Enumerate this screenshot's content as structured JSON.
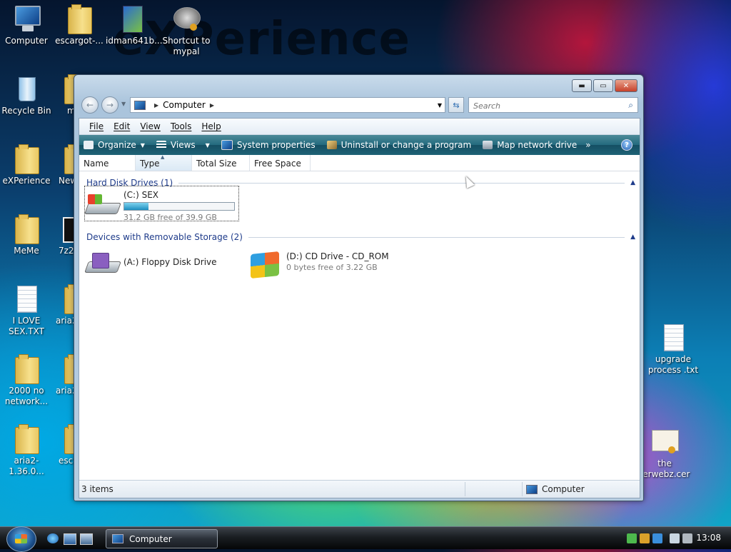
{
  "desktop": {
    "watermark": "eXPerience",
    "icons": [
      {
        "label": "Computer"
      },
      {
        "label": "escargot-..."
      },
      {
        "label": "idman641b..."
      },
      {
        "label": "Shortcut to mypal"
      },
      {
        "label": "Recycle Bin"
      },
      {
        "label": "eXPerience"
      },
      {
        "label": "MeMe"
      },
      {
        "label": "I LOVE SEX.TXT"
      },
      {
        "label": "2000 no network..."
      },
      {
        "label": "aria2-1.36.0..."
      },
      {
        "label": "upgrade process .txt"
      },
      {
        "label": "the terwebz.cer"
      }
    ],
    "partial_labels": [
      "m",
      "New",
      "7z2",
      "aria2",
      "aria2",
      "esca"
    ]
  },
  "window": {
    "address": {
      "location": "Computer"
    },
    "search": {
      "placeholder": "Search"
    },
    "menu": [
      "File",
      "Edit",
      "View",
      "Tools",
      "Help"
    ],
    "commands": {
      "organize": "Organize",
      "views": "Views",
      "system_properties": "System properties",
      "uninstall": "Uninstall or change a program",
      "map_drive": "Map network drive",
      "more": "»"
    },
    "columns": [
      "Name",
      "Type",
      "Total Size",
      "Free Space"
    ],
    "groups": {
      "hard_disks": "Hard Disk Drives (1)",
      "removable": "Devices with Removable Storage (2)"
    },
    "drives": {
      "c": {
        "name": "(C:) SEX",
        "free": "31.2 GB free of 39.9 GB",
        "used_fraction": 0.22
      },
      "a": {
        "name": "(A:) Floppy Disk Drive"
      },
      "d": {
        "name": "(D:) CD Drive - CD_ROM",
        "free": "0 bytes free of 3.22 GB"
      }
    },
    "status": {
      "items": "3 items",
      "location": "Computer"
    }
  },
  "taskbar": {
    "task_label": "Computer",
    "clock": "13:08"
  }
}
